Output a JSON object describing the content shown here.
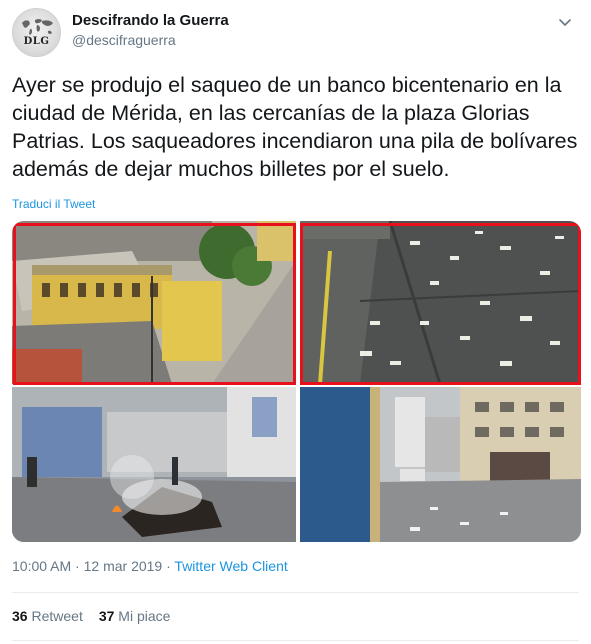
{
  "author": {
    "name": "Descifrando la Guerra",
    "handle": "@descifraguerra",
    "avatar_text": "DLG"
  },
  "tweet": {
    "text": "Ayer se produjo el saqueo de un banco bicentenario en la ciudad de Mérida, en las cercanías de la plaza Glorias Patrias. Los saqueadores incendiaron una pila de bolívares además de dejar muchos billetes por el suelo.",
    "translate_label": "Traduci il Tweet"
  },
  "media": {
    "photos": [
      {
        "description_icon": "photo-rooftops-street",
        "highlighted": true
      },
      {
        "description_icon": "photo-banknotes-on-ground",
        "highlighted": true
      },
      {
        "description_icon": "photo-burning-pile-street",
        "highlighted": false
      },
      {
        "description_icon": "photo-street-corner-buildings",
        "highlighted": false
      }
    ],
    "highlight_color": "#e8101a"
  },
  "meta": {
    "time": "10:00 AM",
    "separator": " · ",
    "date": "12 mar 2019",
    "client": "Twitter Web Client"
  },
  "stats": {
    "retweets_count": "36",
    "retweets_label": "Retweet",
    "likes_count": "37",
    "likes_label": "Mi piace"
  },
  "colors": {
    "link": "#1b95e0",
    "secondary_text": "#657786",
    "primary_text": "#14171a"
  }
}
